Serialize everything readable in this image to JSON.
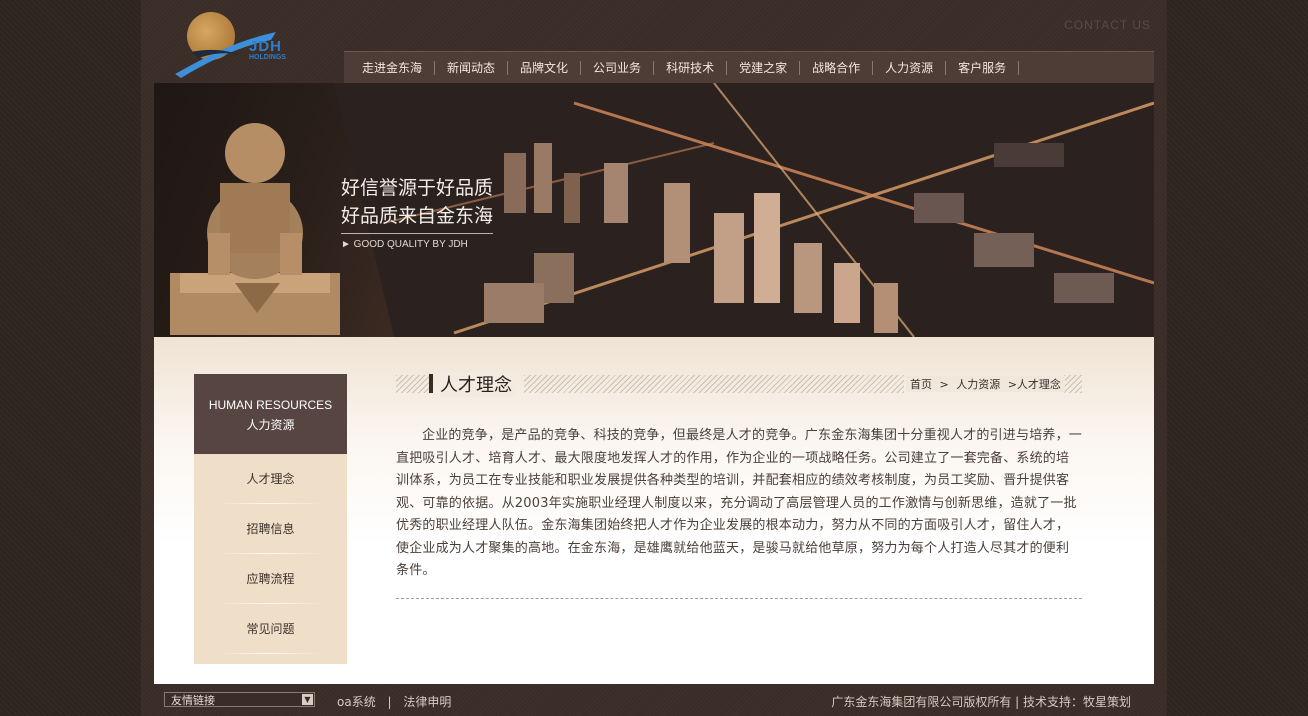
{
  "header": {
    "logo_main": "JDH",
    "logo_sub": "HOLDINGS",
    "contact": "CONTACT US"
  },
  "nav": {
    "items": [
      "走进金东海",
      "新闻动态",
      "品牌文化",
      "公司业务",
      "科研技术",
      "党建之家",
      "战略合作",
      "人力资源",
      "客户服务"
    ]
  },
  "banner": {
    "line1": "好信誉源于好品质",
    "line2": "好品质来自金东海",
    "sub": "► GOOD QUALITY BY JDH"
  },
  "sidebar": {
    "title_en": "HUMAN RESOURCES",
    "title_cn": "人力资源",
    "items": [
      "人才理念",
      "招聘信息",
      "应聘流程",
      "常见问题"
    ]
  },
  "main": {
    "title": "人才理念",
    "breadcrumb": [
      "首页",
      ">",
      "人力资源",
      ">人才理念"
    ],
    "paragraph": "企业的竞争，是产品的竞争、科技的竞争，但最终是人才的竞争。广东金东海集团十分重视人才的引进与培养，一直把吸引人才、培育人才、最大限度地发挥人才的作用，作为企业的一项战略任务。公司建立了一套完备、系统的培训体系，为员工在专业技能和职业发展提供各种类型的培训，并配套相应的绩效考核制度，为员工奖励、晋升提供客观、可靠的依据。从2003年实施职业经理人制度以来，充分调动了高层管理人员的工作激情与创新思维，造就了一批优秀的职业经理人队伍。金东海集团始终把人才作为企业发展的根本动力，努力从不同的方面吸引人才，留住人才，使企业成为人才聚集的高地。在金东海，是雄鹰就给他蓝天，是骏马就给他草原，努力为每个人打造人尽其才的便利条件。"
  },
  "footer": {
    "select_value": "友情链接",
    "links": [
      "oa系统",
      "|",
      "法律申明"
    ],
    "copyright": "广东金东海集团有限公司版权所有 |   技术支持：牧星策划"
  },
  "icons": {
    "dropdown": "chevron-down-icon",
    "logo": "jdh-logo-icon",
    "lion": "lion-statue-image"
  }
}
